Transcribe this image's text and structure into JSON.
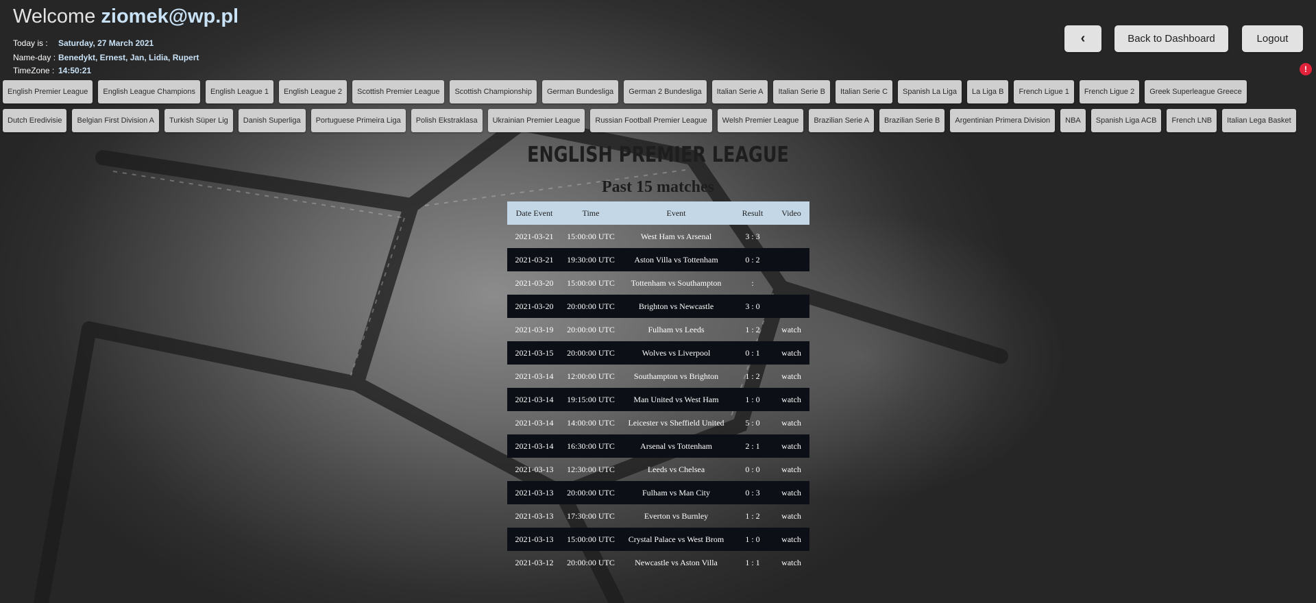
{
  "header": {
    "welcome_prefix": "Welcome",
    "user": "ziomek@wp.pl",
    "today_label": "Today is :",
    "today_value": "Saturday, 27 March 2021",
    "nameday_label": "Name-day :",
    "nameday_value": "Benedykt, Ernest, Jan, Lidia, Rupert",
    "timezone_label": "TimeZone :",
    "timezone_value": "14:50:21",
    "back_icon": "‹",
    "dashboard_label": "Back to Dashboard",
    "logout_label": "Logout",
    "alert_glyph": "!"
  },
  "leagues": [
    "English Premier League",
    "English League Champions",
    "English League 1",
    "English League 2",
    "Scottish Premier League",
    "Scottish Championship",
    "German Bundesliga",
    "German 2 Bundesliga",
    "Italian Serie A",
    "Italian Serie B",
    "Italian Serie C",
    "Spanish La Liga",
    "La Liga B",
    "French Ligue 1",
    "French Ligue 2",
    "Greek Superleague Greece",
    "Dutch Eredivisie",
    "Belgian First Division A",
    "Turkish Süper Lig",
    "Danish Superliga",
    "Portuguese Primeira Liga",
    "Polish Ekstraklasa",
    "Ukrainian Premier League",
    "Russian Football Premier League",
    "Welsh Premier League",
    "Brazilian Serie A",
    "Brazilian Serie B",
    "Argentinian Primera Division",
    "NBA",
    "Spanish Liga ACB",
    "French LNB",
    "Italian Lega Basket"
  ],
  "main": {
    "league_title": "ENGLISH PREMIER LEAGUE",
    "section_title": "Past 15 matches"
  },
  "table": {
    "columns": [
      "Date Event",
      "Time",
      "Event",
      "Result",
      "Video"
    ],
    "rows": [
      {
        "date": "2021-03-21",
        "time": "15:00:00 UTC",
        "event": "West Ham vs Arsenal",
        "result": "3 : 3",
        "video": ""
      },
      {
        "date": "2021-03-21",
        "time": "19:30:00 UTC",
        "event": "Aston Villa vs Tottenham",
        "result": "0 : 2",
        "video": ""
      },
      {
        "date": "2021-03-20",
        "time": "15:00:00 UTC",
        "event": "Tottenham vs Southampton",
        "result": ":",
        "video": ""
      },
      {
        "date": "2021-03-20",
        "time": "20:00:00 UTC",
        "event": "Brighton vs Newcastle",
        "result": "3 : 0",
        "video": ""
      },
      {
        "date": "2021-03-19",
        "time": "20:00:00 UTC",
        "event": "Fulham vs Leeds",
        "result": "1 : 2",
        "video": "watch"
      },
      {
        "date": "2021-03-15",
        "time": "20:00:00 UTC",
        "event": "Wolves vs Liverpool",
        "result": "0 : 1",
        "video": "watch"
      },
      {
        "date": "2021-03-14",
        "time": "12:00:00 UTC",
        "event": "Southampton vs Brighton",
        "result": "1 : 2",
        "video": "watch"
      },
      {
        "date": "2021-03-14",
        "time": "19:15:00 UTC",
        "event": "Man United vs West Ham",
        "result": "1 : 0",
        "video": "watch"
      },
      {
        "date": "2021-03-14",
        "time": "14:00:00 UTC",
        "event": "Leicester vs Sheffield United",
        "result": "5 : 0",
        "video": "watch"
      },
      {
        "date": "2021-03-14",
        "time": "16:30:00 UTC",
        "event": "Arsenal vs Tottenham",
        "result": "2 : 1",
        "video": "watch"
      },
      {
        "date": "2021-03-13",
        "time": "12:30:00 UTC",
        "event": "Leeds vs Chelsea",
        "result": "0 : 0",
        "video": "watch"
      },
      {
        "date": "2021-03-13",
        "time": "20:00:00 UTC",
        "event": "Fulham vs Man City",
        "result": "0 : 3",
        "video": "watch"
      },
      {
        "date": "2021-03-13",
        "time": "17:30:00 UTC",
        "event": "Everton vs Burnley",
        "result": "1 : 2",
        "video": "watch"
      },
      {
        "date": "2021-03-13",
        "time": "15:00:00 UTC",
        "event": "Crystal Palace vs West Brom",
        "result": "1 : 0",
        "video": "watch"
      },
      {
        "date": "2021-03-12",
        "time": "20:00:00 UTC",
        "event": "Newcastle vs Aston Villa",
        "result": "1 : 1",
        "video": "watch"
      }
    ]
  }
}
